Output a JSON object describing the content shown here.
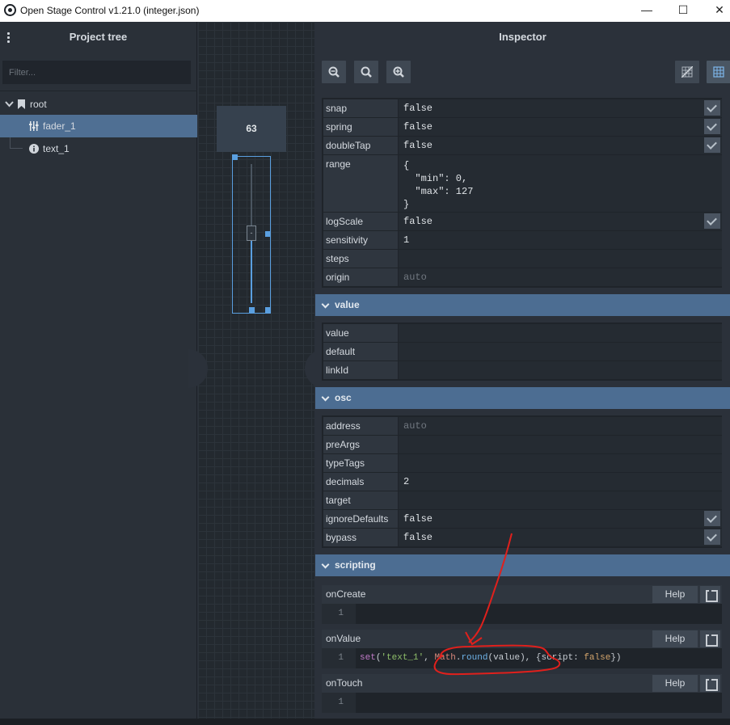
{
  "window": {
    "title": "Open Stage Control v1.21.0 (integer.json)",
    "min_glyph": "—",
    "max_glyph": "☐",
    "close_glyph": "✕"
  },
  "project_tree": {
    "header": "Project tree",
    "filter_placeholder": "Filter...",
    "items": [
      {
        "label": "root",
        "icon": "bookmark-icon"
      },
      {
        "label": "fader_1",
        "icon": "fader-icon",
        "selected": true
      },
      {
        "label": "text_1",
        "icon": "info-icon"
      }
    ]
  },
  "canvas": {
    "fader_value": "63",
    "knob_glyph": "-"
  },
  "inspector": {
    "header": "Inspector",
    "toolbar": [
      "zoom-out-icon",
      "zoom-reset-icon",
      "zoom-in-icon",
      "no-grid-icon",
      "grid-icon"
    ],
    "props_top": [
      {
        "key": "snap",
        "value": "false",
        "checkbox": true
      },
      {
        "key": "spring",
        "value": "false",
        "checkbox": true
      },
      {
        "key": "doubleTap",
        "value": "false",
        "checkbox": true
      },
      {
        "key": "range",
        "value": "{\n  \"min\": 0,\n  \"max\": 127\n}"
      },
      {
        "key": "logScale",
        "value": "false",
        "checkbox": true
      },
      {
        "key": "sensitivity",
        "value": "1"
      },
      {
        "key": "steps",
        "value": ""
      },
      {
        "key": "origin",
        "value": "auto",
        "placeholder": true
      }
    ],
    "section_value": "value",
    "props_value": [
      {
        "key": "value",
        "value": ""
      },
      {
        "key": "default",
        "value": ""
      },
      {
        "key": "linkId",
        "value": ""
      }
    ],
    "section_osc": "osc",
    "props_osc": [
      {
        "key": "address",
        "value": "auto",
        "placeholder": true
      },
      {
        "key": "preArgs",
        "value": ""
      },
      {
        "key": "typeTags",
        "value": ""
      },
      {
        "key": "decimals",
        "value": "2"
      },
      {
        "key": "target",
        "value": ""
      },
      {
        "key": "ignoreDefaults",
        "value": "false",
        "checkbox": true
      },
      {
        "key": "bypass",
        "value": "false",
        "checkbox": true
      }
    ],
    "section_scripting": "scripting",
    "scripts": [
      {
        "name": "onCreate",
        "help": "Help",
        "line": "1",
        "code": ""
      },
      {
        "name": "onValue",
        "help": "Help",
        "line": "1",
        "code_parts": [
          "set",
          "(",
          "'text_1'",
          ", ",
          "Math",
          ".",
          "round",
          "(value), {script: ",
          "false",
          "})"
        ]
      },
      {
        "name": "onTouch",
        "help": "Help",
        "line": "1",
        "code": ""
      }
    ]
  },
  "colors": {
    "accent": "#4c6d92",
    "selection": "#5a9fe0",
    "annotation": "#e0201c"
  }
}
